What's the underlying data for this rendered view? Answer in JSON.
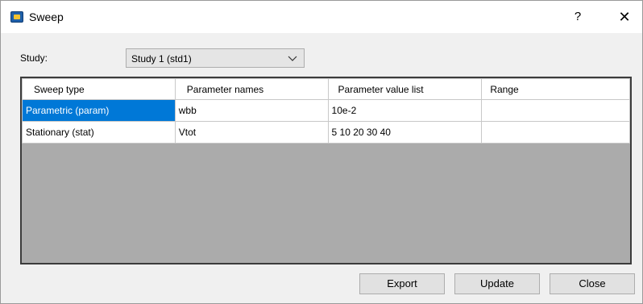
{
  "window": {
    "title": "Sweep",
    "help_glyph": "?",
    "close_glyph": "✕"
  },
  "study": {
    "label": "Study:",
    "selected": "Study 1 (std1)"
  },
  "table": {
    "headers": [
      "Sweep type",
      "Parameter names",
      "Parameter value list",
      "Range"
    ],
    "rows": [
      [
        "Parametric (param)",
        "wbb",
        "10e-2",
        ""
      ],
      [
        "Stationary (stat)",
        "Vtot",
        "5 10 20 30 40",
        ""
      ]
    ],
    "selected_row": 0
  },
  "buttons": {
    "export": "Export",
    "update": "Update",
    "close": "Close"
  },
  "colors": {
    "selection": "#0078d7",
    "empty_area": "#ababab"
  },
  "icons": {
    "app": "app-icon",
    "dropdown": "chevron-down-icon"
  }
}
